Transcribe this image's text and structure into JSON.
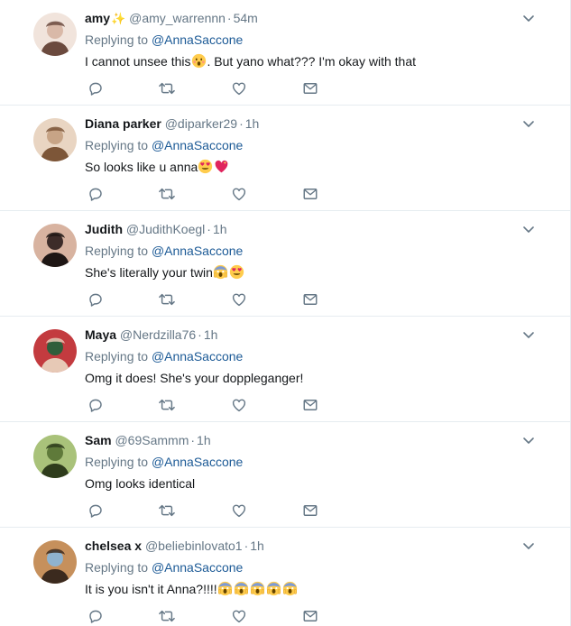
{
  "colors": {
    "accent": "#1c5a96",
    "secondary_text": "#657786",
    "icon": "#657786",
    "divider": "#e6ecf0"
  },
  "reply_label": "Replying to",
  "reply_target": "@AnnaSaccone",
  "icons": {
    "reply": "reply-icon",
    "retweet": "retweet-icon",
    "like": "heart-icon",
    "dm": "envelope-icon",
    "more": "chevron-down-icon"
  },
  "tweets": [
    {
      "fullname": "amy",
      "has_sparkle": true,
      "sparkle": "✨",
      "username": "@amy_warrennn",
      "time": "54m",
      "text_before": "I cannot unsee this",
      "emojis": [
        "astonished-face"
      ],
      "text_after": ". But yano what??? I'm okay with that",
      "avatar_colors": [
        "#d9b9a8",
        "#f1e4dc",
        "#6b4a3e"
      ]
    },
    {
      "fullname": "Diana parker",
      "username": "@diparker29",
      "time": "1h",
      "text_before": "So looks like u anna",
      "emojis": [
        "heart-eyes-face",
        "sparkling-heart"
      ],
      "text_after": "",
      "avatar_colors": [
        "#c7a486",
        "#e9d5c2",
        "#7d5638"
      ]
    },
    {
      "fullname": "Judith",
      "username": "@JudithKoegl",
      "time": "1h",
      "text_before": "She's literally your twin",
      "emojis": [
        "screaming-face",
        "heart-eyes-face"
      ],
      "text_after": "",
      "avatar_colors": [
        "#3d2c29",
        "#d8b3a0",
        "#1e1614"
      ]
    },
    {
      "fullname": "Maya",
      "username": "@Nerdzilla76",
      "time": "1h",
      "text_before": "Omg it does! She's your doppleganger!",
      "emojis": [],
      "text_after": "",
      "avatar_colors": [
        "#2f5e3b",
        "#c33b3f",
        "#e7c9b6"
      ]
    },
    {
      "fullname": "Sam",
      "username": "@69Sammm",
      "time": "1h",
      "text_before": "Omg looks identical",
      "emojis": [],
      "text_after": "",
      "avatar_colors": [
        "#5f7a3a",
        "#a9c27a",
        "#2e3c1c"
      ]
    },
    {
      "fullname": "chelsea x",
      "username": "@beliebinlovato1",
      "time": "1h",
      "text_before": "It is you isn't it Anna?!!!!",
      "emojis": [
        "screaming-face",
        "screaming-face",
        "screaming-face",
        "screaming-face",
        "screaming-face"
      ],
      "text_after": "",
      "avatar_colors": [
        "#8fb3cf",
        "#c6905c",
        "#3b2a1e"
      ]
    }
  ]
}
